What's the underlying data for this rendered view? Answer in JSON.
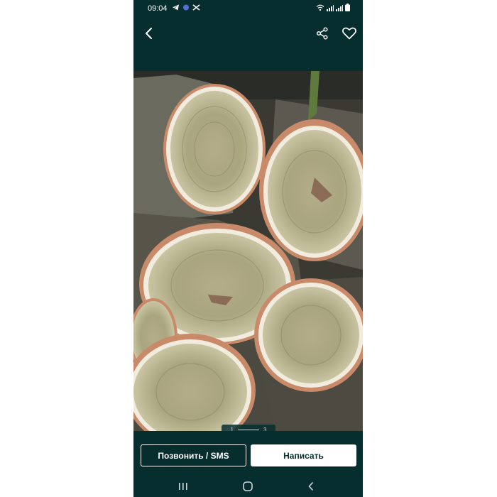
{
  "status_bar": {
    "time": "09:04",
    "left_icons": [
      "telegram-icon",
      "notification-dot-icon",
      "app-badge-icon"
    ],
    "right_icons": [
      "wifi-icon",
      "signal-icon",
      "signal-icon",
      "battery-icon"
    ]
  },
  "app_bar": {
    "icons": [
      "back-arrow-icon",
      "share-icon",
      "heart-icon"
    ]
  },
  "gallery": {
    "current_page": "1",
    "total_pages": "3"
  },
  "actions": {
    "call_label": "Позвонить / SMS",
    "write_label": "Написать"
  },
  "nav_bar": {
    "icons": [
      "recents-icon",
      "home-icon",
      "back-icon"
    ]
  },
  "colors": {
    "app_bg": "#062e2e",
    "button_fg": "#ffffff"
  }
}
